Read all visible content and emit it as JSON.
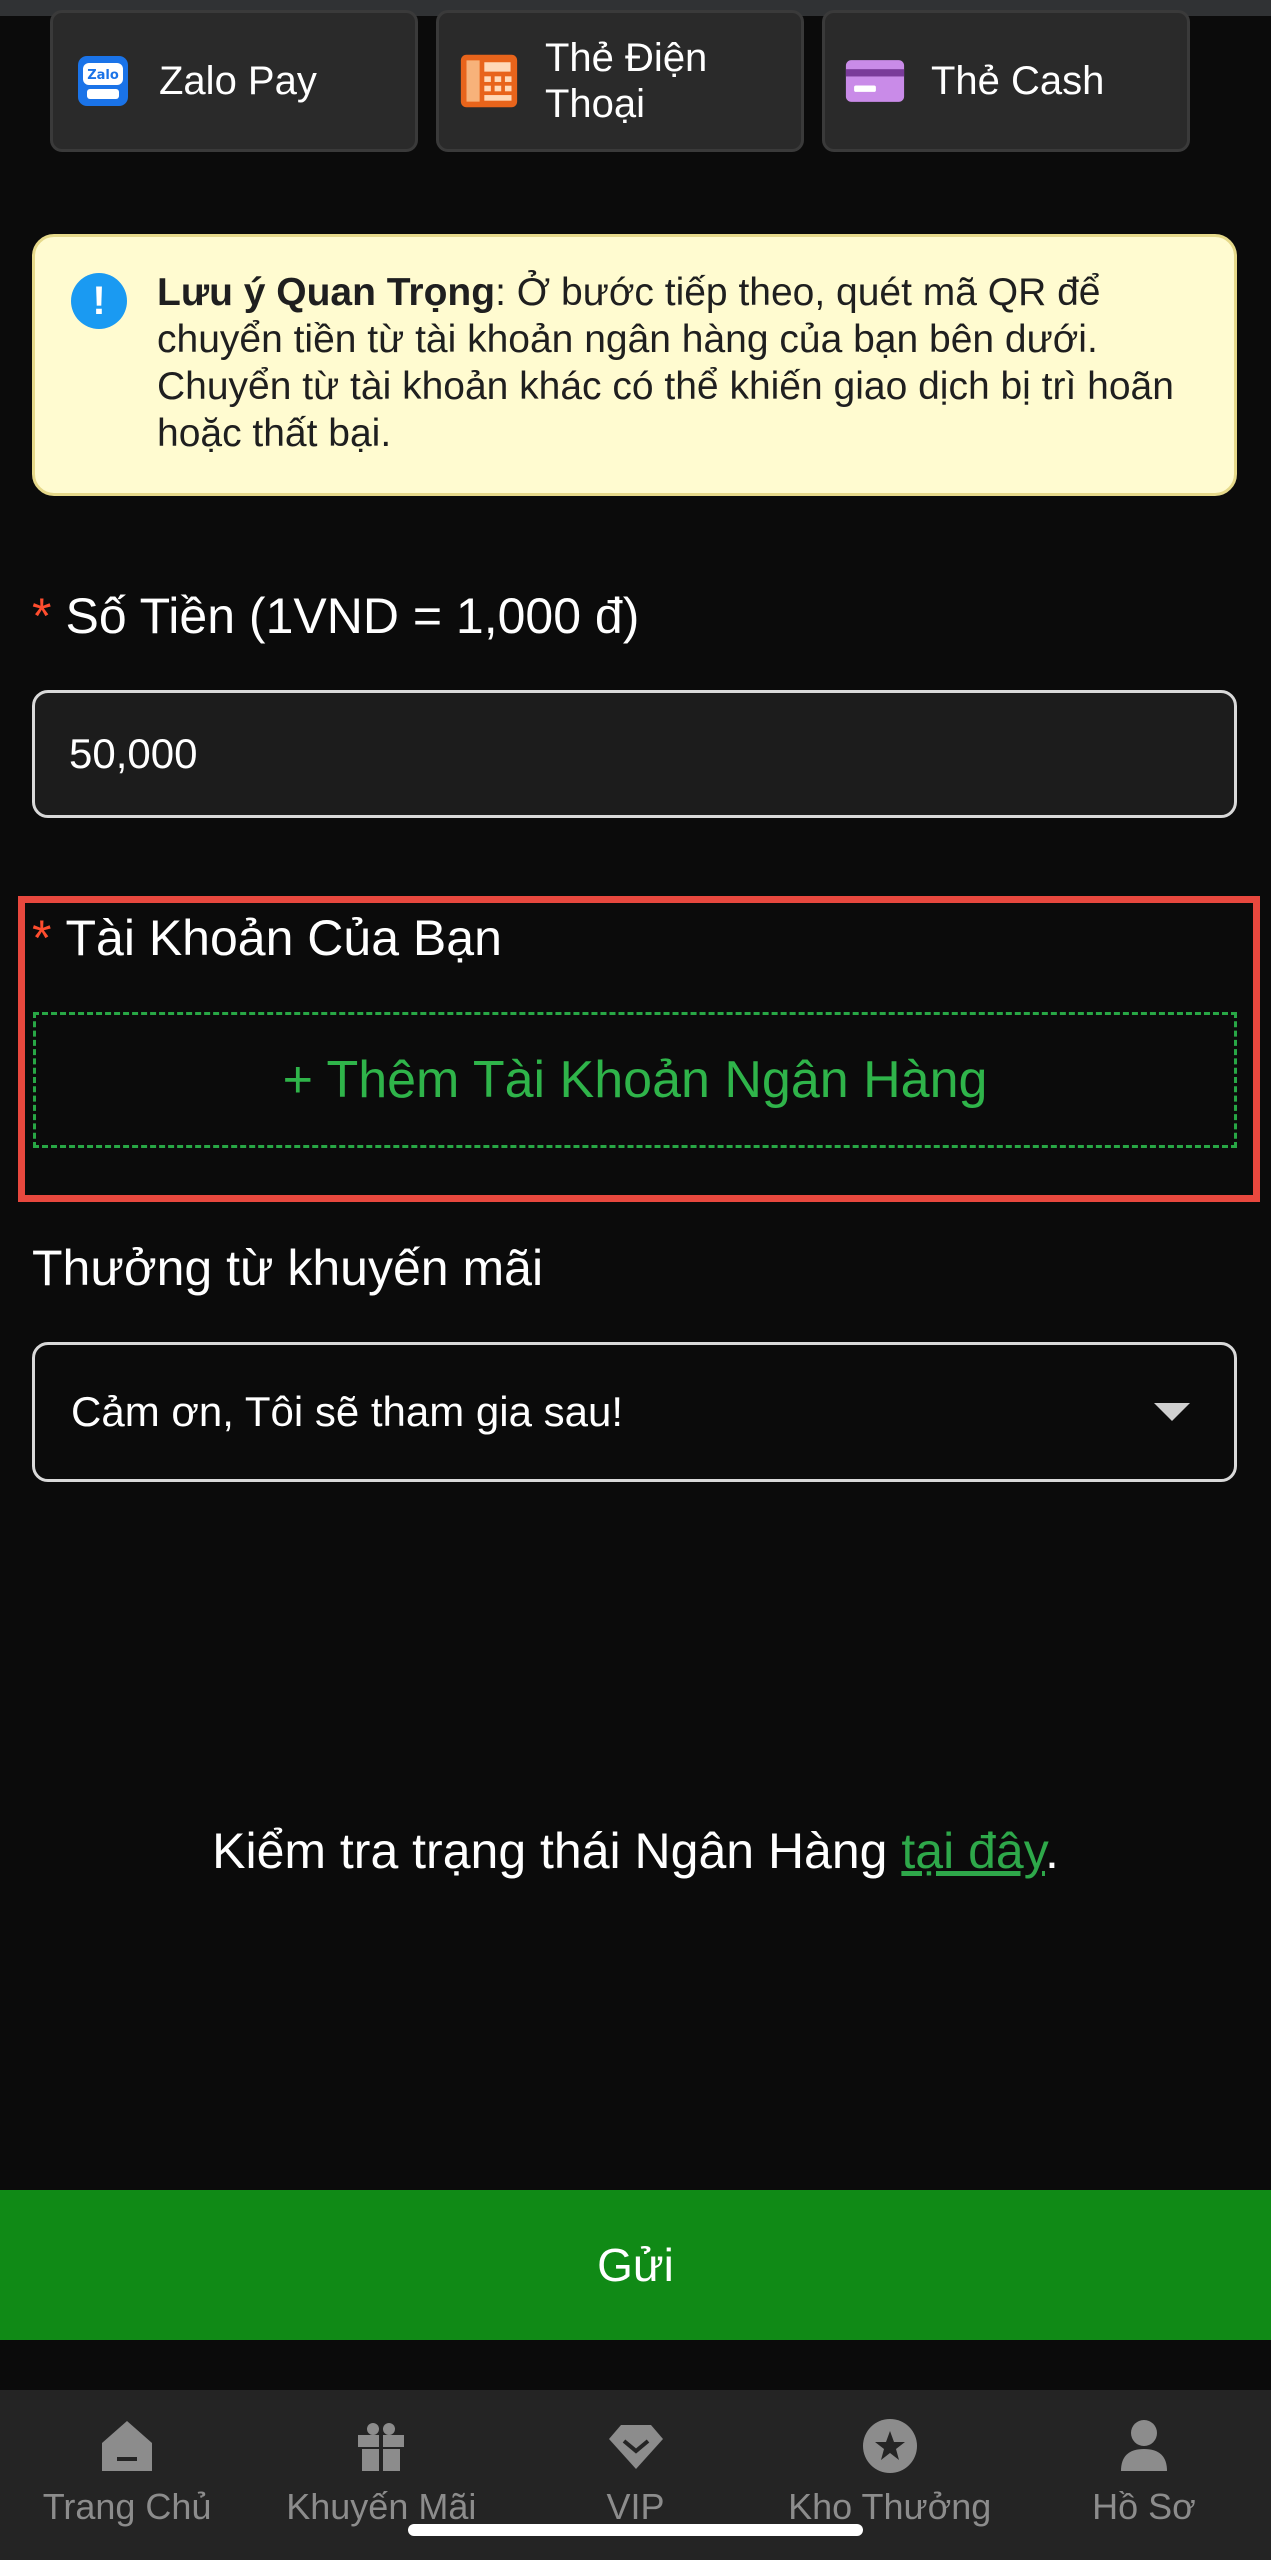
{
  "payment_methods": [
    {
      "label": "Zalo Pay",
      "icon": "zalopay-icon"
    },
    {
      "label": "Thẻ Điện Thoại",
      "icon": "phone-card-icon"
    },
    {
      "label": "Thẻ Cash",
      "icon": "cash-card-icon"
    }
  ],
  "notice": {
    "title": "Lưu ý Quan Trọng",
    "body": ": Ở bước tiếp theo, quét mã QR để chuyển tiền từ tài khoản ngân hàng của bạn bên dưới. Chuyển từ tài khoản khác có thể khiến giao dịch bị trì hoãn hoặc thất bại."
  },
  "amount": {
    "required_mark": "*",
    "label": "Số Tiền (1VND = 1,000 đ)",
    "value": "50,000"
  },
  "account": {
    "required_mark": "*",
    "label": "Tài Khoản Của Bạn",
    "add_button": "+ Thêm Tài Khoản Ngân Hàng"
  },
  "promotion": {
    "label": "Thưởng từ khuyến mãi",
    "selected": "Cảm ơn, Tôi sẽ tham gia sau!"
  },
  "bank_status": {
    "prefix": "Kiểm tra trạng thái Ngân Hàng ",
    "link": "tại đây",
    "suffix": "."
  },
  "submit_label": "Gửi",
  "nav": [
    {
      "label": "Trang Chủ",
      "icon": "home-icon"
    },
    {
      "label": "Khuyến Mãi",
      "icon": "gift-icon"
    },
    {
      "label": "VIP",
      "icon": "vip-icon"
    },
    {
      "label": "Kho Thưởng",
      "icon": "reward-icon"
    },
    {
      "label": "Hồ Sơ",
      "icon": "profile-icon"
    }
  ],
  "colors": {
    "background": "#0b0b0b",
    "accent_green": "#108a16",
    "required_red": "#ff4d2e",
    "highlight_red": "#e8483e",
    "notice_bg": "#fffbd0"
  }
}
